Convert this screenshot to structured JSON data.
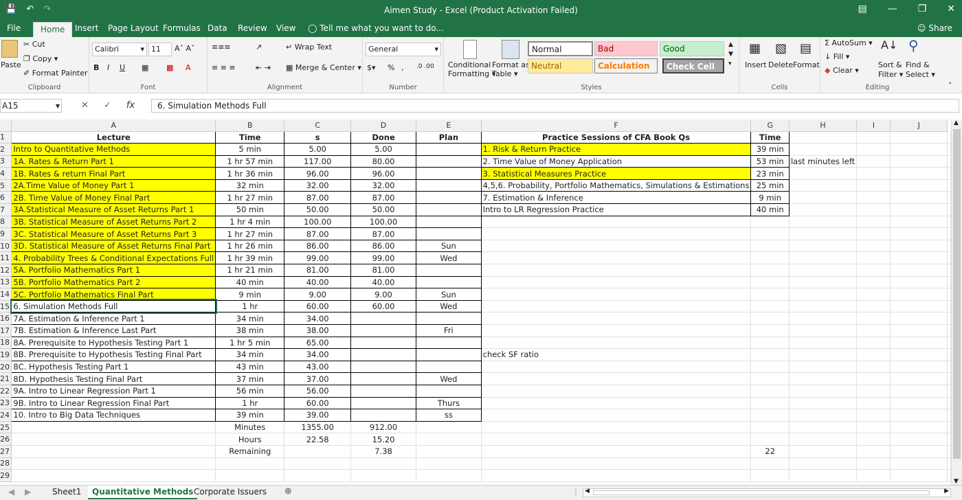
{
  "window": {
    "title": "Aimen Study - Excel (Product Activation Failed)",
    "share_label": "Share"
  },
  "ribbon_tabs": [
    "File",
    "Home",
    "Insert",
    "Page Layout",
    "Formulas",
    "Data",
    "Review",
    "View"
  ],
  "tell_me": "Tell me what you want to do...",
  "ribbon": {
    "clipboard": {
      "paste": "Paste",
      "cut": "Cut",
      "copy": "Copy",
      "format_painter": "Format Painter",
      "label": "Clipboard"
    },
    "font": {
      "name": "Calibri",
      "size": "11",
      "label": "Font"
    },
    "alignment": {
      "wrap": "Wrap Text",
      "merge": "Merge & Center",
      "label": "Alignment"
    },
    "number": {
      "format": "General",
      "label": "Number"
    },
    "styles": {
      "conditional": "Conditional",
      "conditional2": "Formatting",
      "format_as": "Format as",
      "format_as2": "Table",
      "normal": "Normal",
      "bad": "Bad",
      "good": "Good",
      "neutral": "Neutral",
      "calculation": "Calculation",
      "check_cell": "Check Cell",
      "label": "Styles"
    },
    "cells": {
      "insert": "Insert",
      "delete": "Delete",
      "format": "Format",
      "label": "Cells"
    },
    "editing": {
      "autosum": "AutoSum",
      "fill": "Fill",
      "clear": "Clear",
      "sort": "Sort &",
      "sort2": "Filter",
      "find": "Find &",
      "find2": "Select",
      "label": "Editing"
    }
  },
  "formula_bar": {
    "cell": "A15",
    "content": "6. Simulation Methods Full"
  },
  "columns": [
    "A",
    "B",
    "C",
    "D",
    "E",
    "F",
    "G",
    "H",
    "I",
    "J"
  ],
  "rows": [
    [
      "Lecture",
      "Time",
      "s",
      "Done",
      "Plan",
      "Practice Sessions of CFA Book Qs",
      "Time",
      "",
      "",
      ""
    ],
    [
      "Intro to Quantitative Methods",
      "5 min",
      "5.00",
      "5.00",
      "",
      "1. Risk & Return Practice",
      "39 min",
      "",
      "",
      ""
    ],
    [
      "1A. Rates & Return Part 1",
      "1 hr 57 min",
      "117.00",
      "80.00",
      "",
      "2. Time Value of Money Application",
      "53 min",
      "last minutes left",
      "",
      ""
    ],
    [
      "1B. Rates & return Final Part",
      "1 hr 36 min",
      "96.00",
      "96.00",
      "",
      "3. Statistical Measures Practice",
      "23 min",
      "",
      "",
      ""
    ],
    [
      "2A.Time Value of Money Part 1",
      "32 min",
      "32.00",
      "32.00",
      "",
      "4,5,6. Probability, Portfolio Mathematics, Simulations & Estimations",
      "25 min",
      "",
      "",
      ""
    ],
    [
      "2B. Time Value of Money Final Part",
      "1 hr 27 min",
      "87.00",
      "87.00",
      "",
      "7. Estimation & Inference",
      "9 min",
      "",
      "",
      ""
    ],
    [
      "3A.Statistical Measure of Asset Returns Part 1",
      "50 min",
      "50.00",
      "50.00",
      "",
      "Intro to LR Regression Practice",
      "40 min",
      "",
      "",
      ""
    ],
    [
      "3B. Statistical Measure of Asset Returns Part 2",
      "1 hr 4 min",
      "100.00",
      "100.00",
      "",
      "",
      "",
      "",
      "",
      ""
    ],
    [
      "3C. Statistical Measure of Asset Returns Part 3",
      "1 hr 27 min",
      "87.00",
      "87.00",
      "",
      "",
      "",
      "",
      "",
      ""
    ],
    [
      "3D. Statistical Measure of Asset Returns Final Part",
      "1 hr 26 min",
      "86.00",
      "86.00",
      "Sun",
      "",
      "",
      "",
      "",
      ""
    ],
    [
      "4. Probability Trees & Conditional Expectations Full",
      "1 hr 39 min",
      "99.00",
      "99.00",
      "Wed",
      "",
      "",
      "",
      "",
      ""
    ],
    [
      "5A. Portfolio Mathematics Part 1",
      "1 hr 21 min",
      "81.00",
      "81.00",
      "",
      "",
      "",
      "",
      "",
      ""
    ],
    [
      "5B. Portfolio Mathematics Part 2",
      "40 min",
      "40.00",
      "40.00",
      "",
      "",
      "",
      "",
      "",
      ""
    ],
    [
      "5C. Portfolio Mathematics Final Part",
      "9 min",
      "9.00",
      "9.00",
      "Sun",
      "",
      "",
      "",
      "",
      ""
    ],
    [
      "6. Simulation Methods Full",
      "1 hr",
      "60.00",
      "60.00",
      "Wed",
      "",
      "",
      "",
      "",
      ""
    ],
    [
      "7A. Estimation & Inference Part 1",
      "34 min",
      "34.00",
      "",
      "",
      "",
      "",
      "",
      "",
      ""
    ],
    [
      "7B. Estimation & Inference Last Part",
      "38 min",
      "38.00",
      "",
      "Fri",
      "",
      "",
      "",
      "",
      ""
    ],
    [
      "8A. Prerequisite to Hypothesis Testing Part 1",
      "1 hr 5 min",
      "65.00",
      "",
      "",
      "",
      "",
      "",
      "",
      ""
    ],
    [
      "8B. Prerequisite to Hypothesis Testing Final Part",
      "34 min",
      "34.00",
      "",
      "",
      "check SF ratio",
      "",
      "",
      "",
      ""
    ],
    [
      "8C. Hypothesis Testing Part 1",
      "43 min",
      "43.00",
      "",
      "",
      "",
      "",
      "",
      "",
      ""
    ],
    [
      "8D. Hypothesis Testing Final Part",
      "37 min",
      "37.00",
      "",
      "Wed",
      "",
      "",
      "",
      "",
      ""
    ],
    [
      "9A. Intro to Linear Regression Part 1",
      "56 min",
      "56.00",
      "",
      "",
      "",
      "",
      "",
      "",
      ""
    ],
    [
      "9B. Intro to Linear Regression Final Part",
      "1 hr",
      "60.00",
      "",
      "Thurs",
      "",
      "",
      "",
      "",
      ""
    ],
    [
      "10. Intro to Big Data Techniques",
      "39 min",
      "39.00",
      "",
      "ss",
      "",
      "",
      "",
      "",
      ""
    ],
    [
      "",
      "Minutes",
      "1355.00",
      "912.00",
      "",
      "",
      "",
      "",
      "",
      ""
    ],
    [
      "",
      "Hours",
      "22.58",
      "15.20",
      "",
      "",
      "",
      "",
      "",
      ""
    ],
    [
      "",
      "Remaining",
      "",
      "7.38",
      "",
      "",
      "22",
      "",
      "",
      ""
    ],
    [
      "",
      "",
      "",
      "",
      "",
      "",
      "",
      "",
      "",
      ""
    ],
    [
      "",
      "",
      "",
      "",
      "",
      "",
      "",
      "",
      "",
      ""
    ]
  ],
  "sheet_tabs": [
    "Sheet1",
    "Quantitative Methods",
    "Corporate Issuers"
  ],
  "active_sheet": "Quantitative Methods",
  "colors": {
    "excel_green": "#217346",
    "highlight_yellow": "#ffff00"
  }
}
